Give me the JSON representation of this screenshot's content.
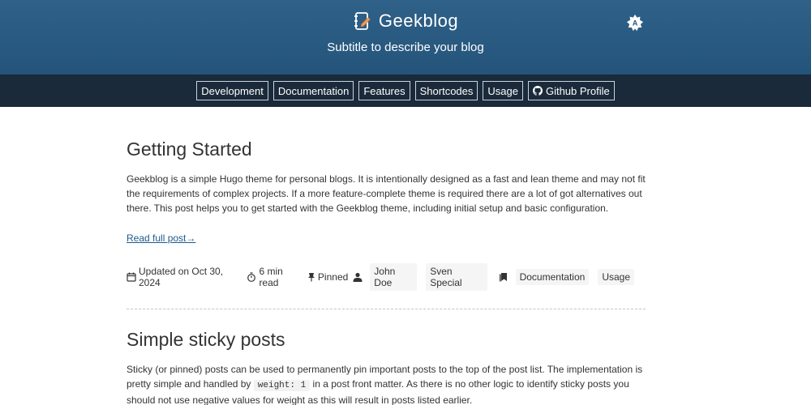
{
  "header": {
    "title": "Geekblog",
    "subtitle": "Subtitle to describe your blog",
    "logo_icon": "notebook-pen-icon",
    "theme_toggle_icon": "auto-theme-icon"
  },
  "menu": {
    "items": [
      {
        "label": "Development"
      },
      {
        "label": "Documentation"
      },
      {
        "label": "Features"
      },
      {
        "label": "Shortcodes"
      },
      {
        "label": "Usage"
      },
      {
        "label": "Github Profile",
        "icon": "github-icon"
      }
    ]
  },
  "posts": [
    {
      "title": "Getting Started",
      "excerpt": "Geekblog is a simple Hugo theme for personal blogs. It is intentionally designed as a fast and lean theme and may not fit the requirements of complex projects. If a more feature-complete theme is required there are a lot of got alternatives out there. This post helps you to get started with the Geekblog theme, including initial setup and basic configuration.",
      "read_more": "Read full post→",
      "meta": {
        "updated": "Updated on Oct 30, 2024",
        "read_time": "6 min read",
        "pinned": "Pinned",
        "authors": [
          "John Doe",
          "Sven Special"
        ],
        "tags": [
          "Documentation",
          "Usage"
        ]
      }
    },
    {
      "title": "Simple sticky posts",
      "excerpt_part1": "Sticky (or pinned) posts can be used to permanently pin important posts to the top of the post list. The implementation is pretty simple and handled by",
      "excerpt_code": "weight: 1",
      "excerpt_part2": "in a post front matter. As there is no other logic to identify sticky posts you should not use negative values for weight as this will result in posts listed earlier."
    }
  ],
  "colors": {
    "header_bg": "#2a5b84",
    "menu_bg": "#1a2a3a",
    "link": "#1f5a8c"
  }
}
